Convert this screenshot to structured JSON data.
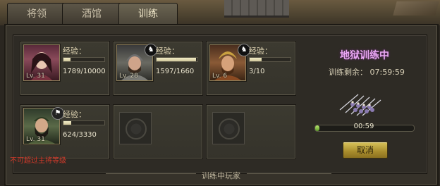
{
  "tabs": [
    {
      "label": "将领"
    },
    {
      "label": "酒馆"
    },
    {
      "label": "训练"
    }
  ],
  "active_tab": "训练",
  "generals": [
    {
      "exp_label": "经验：",
      "exp": "1789/10000",
      "exp_fraction": 0.18,
      "level": "Lv. 31",
      "mount": false
    },
    {
      "exp_label": "经验：",
      "exp": "1597/1660",
      "exp_fraction": 0.96,
      "level": "Lv. 28",
      "mount": true
    },
    {
      "exp_label": "经验：",
      "exp": "3/10",
      "exp_fraction": 0.3,
      "level": "Lv. 6",
      "mount": true
    },
    {
      "exp_label": "经验：",
      "exp": "624/3330",
      "exp_fraction": 0.19,
      "level": "Lv. 31",
      "mount": true
    }
  ],
  "warning": "不可超过主将等级",
  "footer_label": "训练中玩家",
  "training": {
    "title": "地狱训练中",
    "remaining": "训练剩余： 07:59:59",
    "progress_text": "00:59",
    "progress_fraction": 0.04,
    "cancel_label": "取消"
  },
  "colors": {
    "title": "#e9a8f2",
    "warning": "#d03a2a",
    "button": "#c9b04a"
  }
}
